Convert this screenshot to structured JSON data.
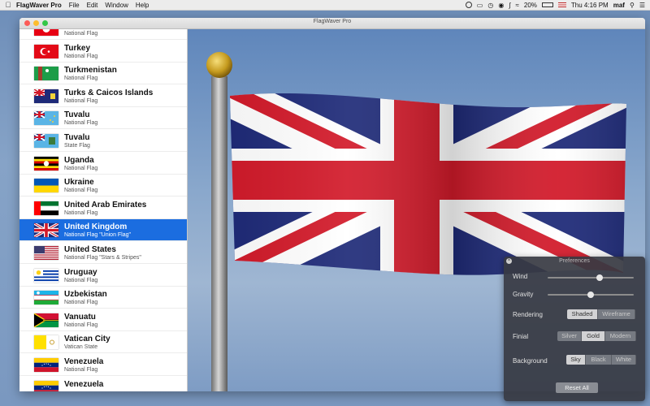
{
  "menubar": {
    "app_name": "FlagWaver Pro",
    "menus": [
      "File",
      "Edit",
      "Window",
      "Help"
    ],
    "battery": "20%",
    "clock": "Thu 4:16 PM",
    "user": "maf"
  },
  "window": {
    "title": "FlagWaver Pro"
  },
  "flags": [
    {
      "name": "",
      "subtitle": "National Flag",
      "flag": "tunisia",
      "selected": false
    },
    {
      "name": "Turkey",
      "subtitle": "National Flag",
      "flag": "turkey",
      "selected": false
    },
    {
      "name": "Turkmenistan",
      "subtitle": "National Flag",
      "flag": "turkmenistan",
      "selected": false
    },
    {
      "name": "Turks & Caicos Islands",
      "subtitle": "National Flag",
      "flag": "turks-caicos",
      "selected": false
    },
    {
      "name": "Tuvalu",
      "subtitle": "National Flag",
      "flag": "tuvalu",
      "selected": false
    },
    {
      "name": "Tuvalu",
      "subtitle": "State Flag",
      "flag": "tuvalu-state",
      "selected": false
    },
    {
      "name": "Uganda",
      "subtitle": "National Flag",
      "flag": "uganda",
      "selected": false
    },
    {
      "name": "Ukraine",
      "subtitle": "National Flag",
      "flag": "ukraine",
      "selected": false
    },
    {
      "name": "United Arab Emirates",
      "subtitle": "National Flag",
      "flag": "uae",
      "selected": false
    },
    {
      "name": "United Kingdom",
      "subtitle": "National Flag \"Union Flag\"",
      "flag": "uk",
      "selected": true
    },
    {
      "name": "United States",
      "subtitle": "National Flag \"Stars & Stripes\"",
      "flag": "usa",
      "selected": false
    },
    {
      "name": "Uruguay",
      "subtitle": "National Flag",
      "flag": "uruguay",
      "selected": false
    },
    {
      "name": "Uzbekistan",
      "subtitle": "National Flag",
      "flag": "uzbekistan",
      "selected": false
    },
    {
      "name": "Vanuatu",
      "subtitle": "National Flag",
      "flag": "vanuatu",
      "selected": false
    },
    {
      "name": "Vatican City",
      "subtitle": "Vatican State",
      "flag": "vatican",
      "selected": false
    },
    {
      "name": "Venezuela",
      "subtitle": "National Flag",
      "flag": "venezuela",
      "selected": false
    },
    {
      "name": "Venezuela",
      "subtitle": "",
      "flag": "venezuela",
      "selected": false
    }
  ],
  "preferences": {
    "title": "Preferences",
    "wind_label": "Wind",
    "wind_value": 0.6,
    "gravity_label": "Gravity",
    "gravity_value": 0.5,
    "rendering_label": "Rendering",
    "rendering_options": [
      "Shaded",
      "Wireframe"
    ],
    "rendering_selected": "Shaded",
    "finial_label": "Finial",
    "finial_options": [
      "Silver",
      "Gold",
      "Modern"
    ],
    "finial_selected": "Gold",
    "background_label": "Background",
    "background_options": [
      "Sky",
      "Black",
      "White"
    ],
    "background_selected": "Sky",
    "reset_label": "Reset All"
  },
  "colors": {
    "selection": "#1b6de0",
    "uk_blue": "#1e2a78",
    "uk_red": "#d21a2a",
    "pole_ball": "#c59a1e"
  }
}
